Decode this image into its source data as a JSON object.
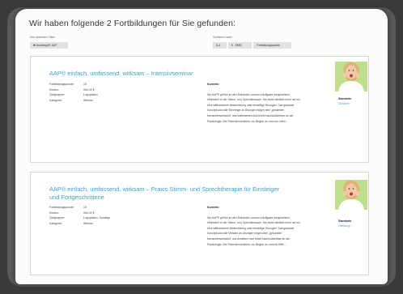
{
  "heading": "Wir haben folgende 2 Fortbildungen für Sie gefunden:",
  "filters": {
    "label": "Ihre aktuellen Filter:",
    "chip": "✖ Suchbegriff: AAP"
  },
  "sort": {
    "label": "Sortieren nach:",
    "options": [
      "A-Z",
      "€ - €€€€",
      "Fortbildungspunkte"
    ]
  },
  "courses": [
    {
      "title": "AAP® einfach, umfassend, wirksam – Intensivseminar",
      "points_label": "Fortbildungspunkte:",
      "points": "15",
      "cost_label": "Kosten:",
      "cost": "390,00 €",
      "target_label": "Zielgruppen:",
      "target": "Logopäden",
      "category_label": "Kategorie:",
      "category": "Stimme",
      "desc_label": "Kurzinfo:",
      "desc": "Die AAP® gehört zu den führenden und am häufigsten eingesetzten Methoden in der Stimm- und Sprechtherapie. Sie bietet deutlich mehr als nur eine willkommene Abwechslung oder einseitige Übungen. Das gesamte Konzept und alle Sinneinge zu Übungen folgen dem „gesamten Menschenverstand“ und widerstehen sich leicht nachvollziehbar an der Physiologie. Die Patienten erfahren vor Beginn an und von mehr...",
      "location_label": "Standorte",
      "location": "München"
    },
    {
      "title": "AAP® einfach, umfassend, wirksam – Praxis Stimm- und Sprechtherapie für Einsteiger und Fortgeschrittene",
      "points_label": "Fortbildungspunkte:",
      "points": "15",
      "cost_label": "Kosten:",
      "cost": "390,00 €",
      "target_label": "Zielgruppen:",
      "target": "Logopäden, Sonstige",
      "category_label": "Kategorie:",
      "category": "Stimme",
      "desc_label": "Kurzinfo:",
      "desc": "Die AAP® gehört zu den führenden und am häufigsten eingesetzten Methoden in der Stimm- und Sprechtherapie. Sie bietet deutlich mehr als nur eine willkommene Abwechslung oder einseitige Übungen. Das gesamte Konzept und alle Vielzahl an Übungen folgen dem „gesunden Menschenverstand“ und erweitern sich leicht nachvollziehbar an der Physiologie. Die Patienten erfahren vor Beginn an und mit Hilfe...",
      "location_label": "Standorte",
      "location": "Hamburg"
    }
  ],
  "colors": {
    "link": "#3aa0d8",
    "avatar_bg": "#bfe08a"
  }
}
